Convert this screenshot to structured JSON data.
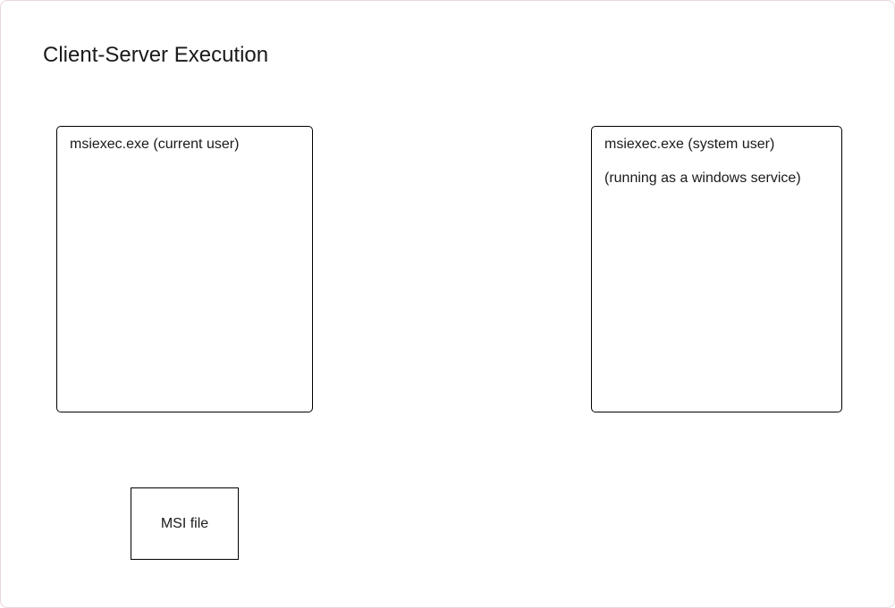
{
  "diagram": {
    "title": "Client-Server Execution",
    "client_box": {
      "label": "msiexec.exe (current user)"
    },
    "server_box": {
      "label": "msiexec.exe (system user)",
      "sublabel": "(running as a windows service)"
    },
    "file_box": {
      "label": "MSI file"
    },
    "colors": {
      "stroke": "#000000",
      "text": "#1a1a1a",
      "canvas_border": "#ead7dc",
      "background": "#ffffff"
    }
  }
}
